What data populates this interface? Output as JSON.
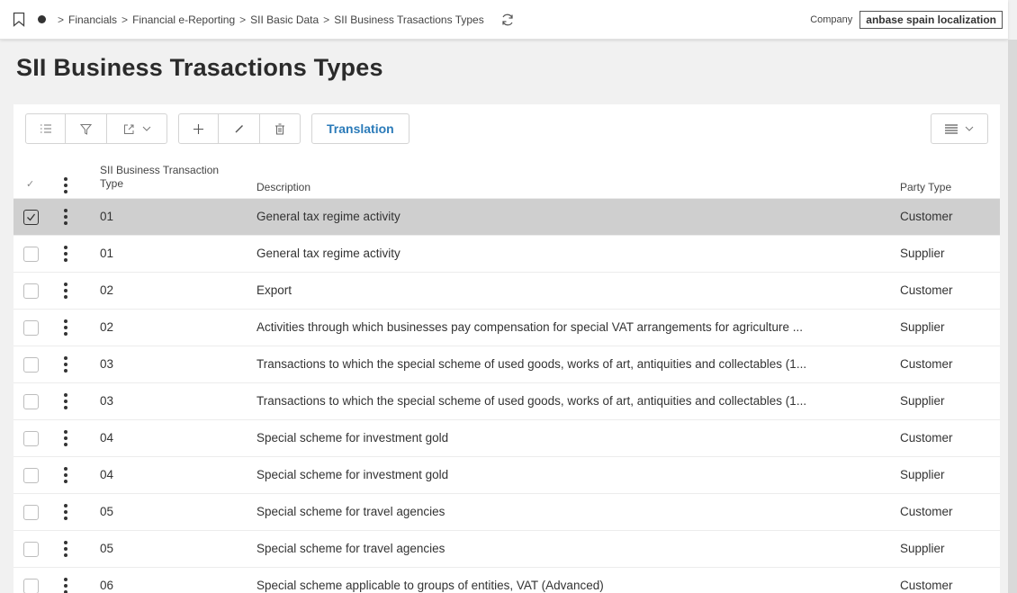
{
  "breadcrumb": {
    "items": [
      "Financials",
      "Financial e-Reporting",
      "SII Basic Data",
      "SII Business Trasactions Types"
    ],
    "separator": ">"
  },
  "company": {
    "label": "Company",
    "value": "anbase spain localization"
  },
  "page": {
    "title": "SII Business Trasactions Types"
  },
  "toolbar": {
    "translation_label": "Translation"
  },
  "table": {
    "columns": {
      "check": "✓",
      "type": "SII Business Transaction Type",
      "description": "Description",
      "party_type": "Party Type"
    },
    "rows": [
      {
        "type": "01",
        "description": "General tax regime activity",
        "party_type": "Customer",
        "selected": true
      },
      {
        "type": "01",
        "description": "General tax regime activity",
        "party_type": "Supplier",
        "selected": false
      },
      {
        "type": "02",
        "description": "Export",
        "party_type": "Customer",
        "selected": false
      },
      {
        "type": "02",
        "description": "Activities through which businesses pay compensation for special VAT arrangements for agriculture ...",
        "party_type": "Supplier",
        "selected": false
      },
      {
        "type": "03",
        "description": "Transactions to which the special scheme of used goods, works of art, antiquities and collectables (1...",
        "party_type": "Customer",
        "selected": false
      },
      {
        "type": "03",
        "description": "Transactions to which the special scheme of used goods, works of art, antiquities and collectables (1...",
        "party_type": "Supplier",
        "selected": false
      },
      {
        "type": "04",
        "description": "Special scheme for investment gold",
        "party_type": "Customer",
        "selected": false
      },
      {
        "type": "04",
        "description": "Special scheme for investment gold",
        "party_type": "Supplier",
        "selected": false
      },
      {
        "type": "05",
        "description": "Special scheme for travel agencies",
        "party_type": "Customer",
        "selected": false
      },
      {
        "type": "05",
        "description": "Special scheme for travel agencies",
        "party_type": "Supplier",
        "selected": false
      },
      {
        "type": "06",
        "description": "Special scheme applicable to groups of entities, VAT (Advanced)",
        "party_type": "Customer",
        "selected": false
      }
    ]
  },
  "colors": {
    "accent": "#2b7bb9",
    "selected_row": "#cfcfcf"
  },
  "icons": [
    "bookmark-icon",
    "home-dot-icon",
    "refresh-icon",
    "list-icon",
    "filter-icon",
    "export-icon",
    "chevron-down-icon",
    "add-icon",
    "edit-icon",
    "delete-icon",
    "view-options-icon",
    "row-menu-icon",
    "checkbox-icon"
  ]
}
